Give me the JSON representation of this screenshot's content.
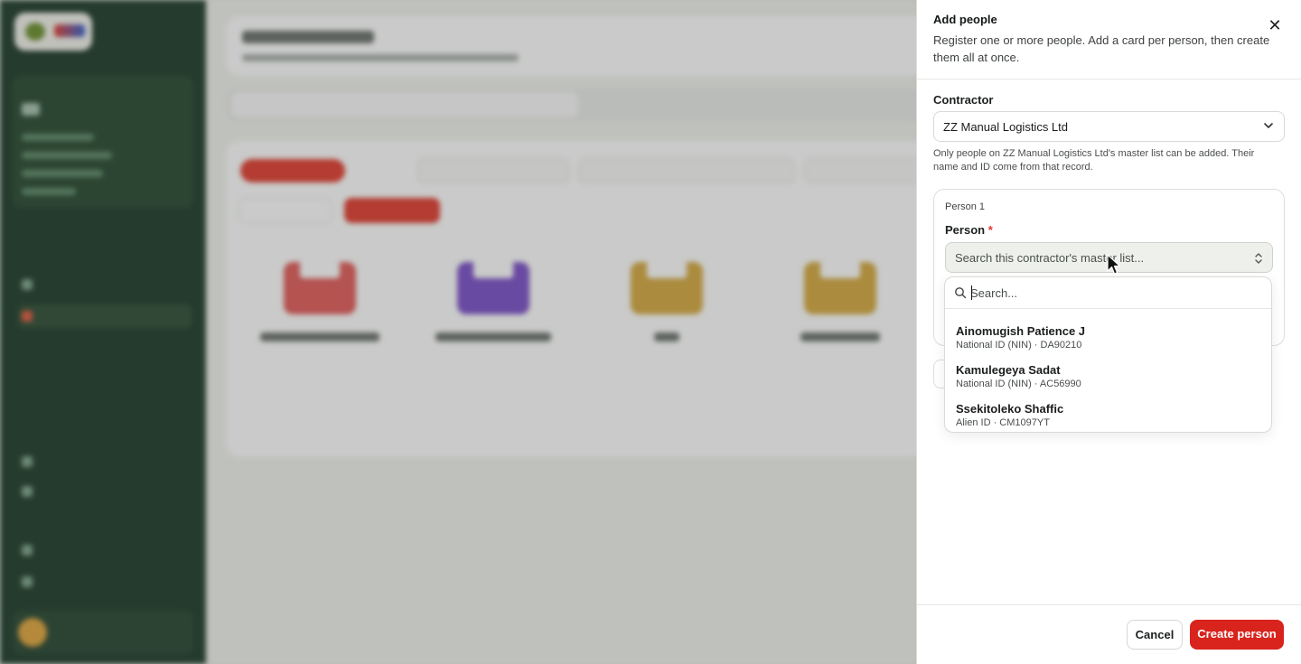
{
  "drawer": {
    "title": "Add people",
    "description": "Register one or more people. Add a card per person, then create them all at once.",
    "contractor": {
      "label": "Contractor",
      "value": "ZZ Manual Logistics Ltd",
      "help": "Only people on ZZ Manual Logistics Ltd's master list can be added. Their name and ID come from that record."
    },
    "person_card": {
      "title": "Person 1",
      "label": "Person",
      "required_mark": "*",
      "placeholder": "Search this contractor's master list..."
    },
    "dropdown": {
      "search_placeholder": "Search...",
      "options": [
        {
          "name": "Ainomugish Patience J",
          "id": "National ID (NIN) · DA90210"
        },
        {
          "name": "Kamulegeya Sadat",
          "id": "National ID (NIN) · AC56990"
        },
        {
          "name": "Ssekitoleko Shaffic",
          "id": "Alien ID · CM1097YT"
        }
      ]
    },
    "footer": {
      "cancel_label": "Cancel",
      "create_label": "Create person"
    }
  },
  "colors": {
    "accent_red": "#d9231d",
    "sidebar_green": "#1d3a27",
    "required_red": "#e0362c"
  },
  "icons": [
    "close-icon",
    "chevron-down-icon",
    "chevron-up-down-icon",
    "search-icon",
    "mouse-cursor-icon"
  ]
}
